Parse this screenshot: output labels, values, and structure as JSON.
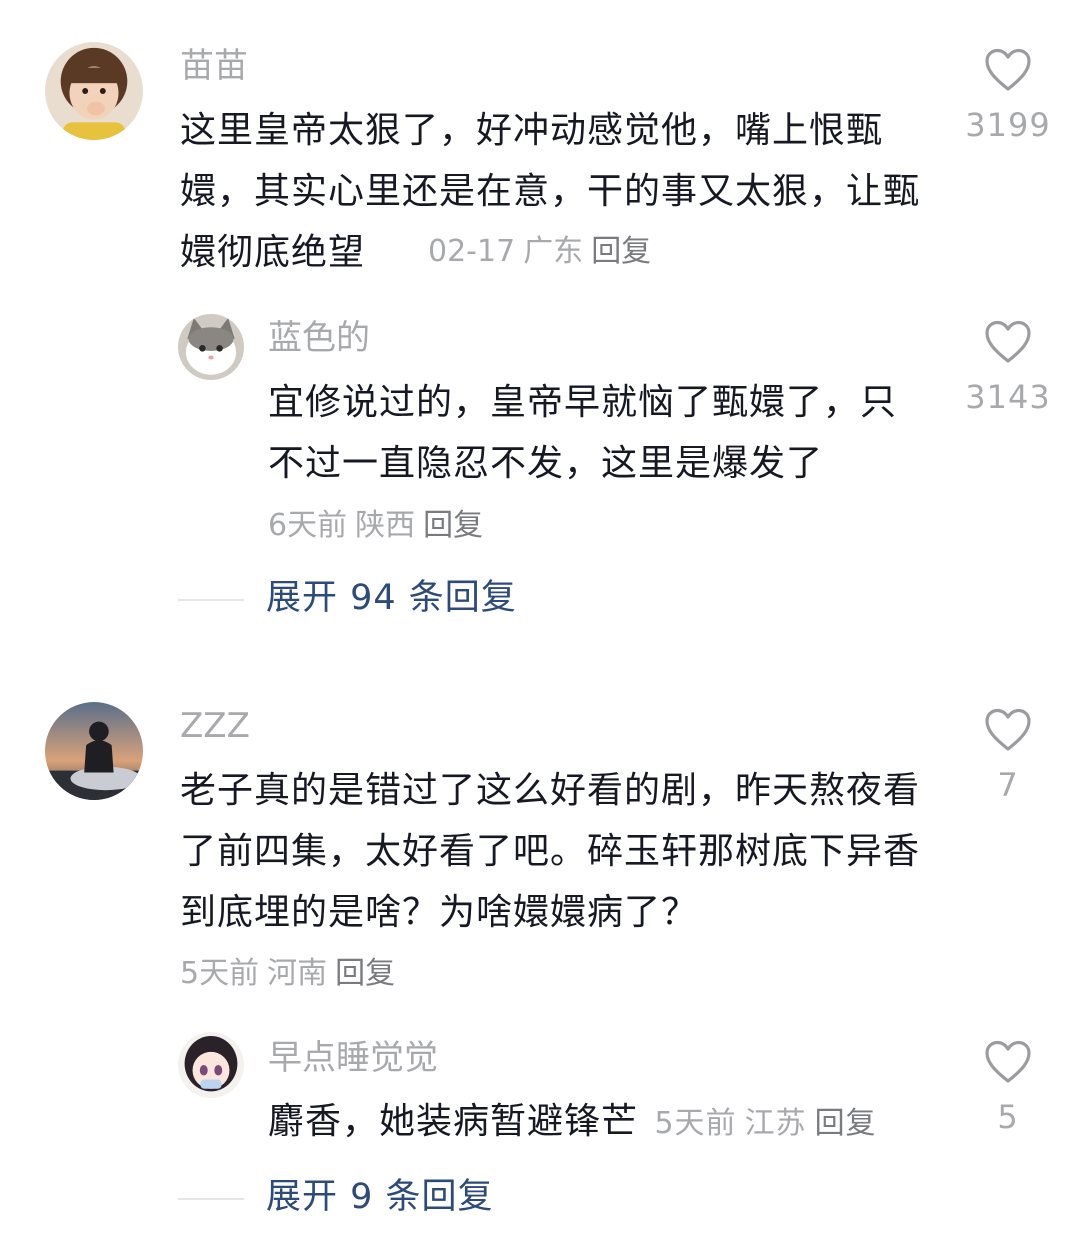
{
  "comments": [
    {
      "username": "苗苗",
      "text": "这里皇帝太狠了，好冲动感觉他，嘴上恨甄嬛，其实心里还是在意，干的事又太狠，让甄嬛彻底绝望",
      "time": "02-17",
      "location": "广东",
      "reply_label": "回复",
      "likes": "3199",
      "replies": [
        {
          "username": "蓝色的",
          "text": "宜修说过的，皇帝早就恼了甄嬛了，只不过一直隐忍不发，这里是爆发了",
          "time": "6天前",
          "location": "陕西",
          "reply_label": "回复",
          "likes": "3143"
        }
      ],
      "expand_label": "展开 94 条回复"
    },
    {
      "username": "ZZZ",
      "text": "老子真的是错过了这么好看的剧，昨天熬夜看了前四集，太好看了吧。碎玉轩那树底下异香到底埋的是啥？为啥嬛嬛病了？",
      "time": "5天前",
      "location": "河南",
      "reply_label": "回复",
      "likes": "7",
      "replies": [
        {
          "username": "早点睡觉觉",
          "text": "麝香，她装病暂避锋芒",
          "time": "5天前",
          "location": "江苏",
          "reply_label": "回复",
          "likes": "5"
        }
      ],
      "expand_label": "展开 9 条回复"
    }
  ],
  "colors": {
    "text": "#161823",
    "meta": "#a8a9ad",
    "link": "#2c4a7a"
  },
  "icons": {
    "like": "heart-outline-icon"
  }
}
